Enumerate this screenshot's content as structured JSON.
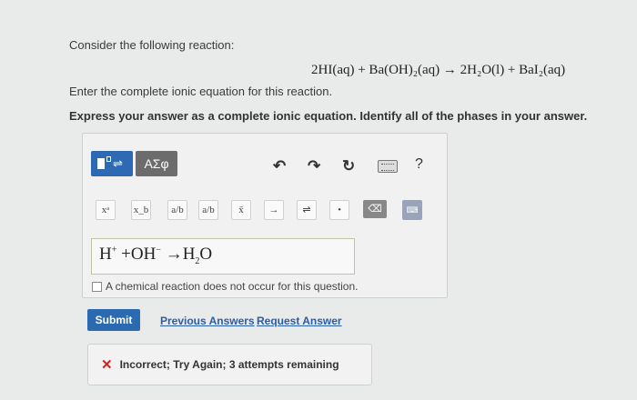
{
  "question": {
    "prompt": "Consider the following reaction:",
    "equation": "2HI(aq) + Ba(OH)₂(aq) → 2H₂O(l) + BaI₂(aq)",
    "instruction": "Enter the complete ionic equation for this reaction.",
    "express": "Express your answer as a complete ionic equation. Identify all of the phases in your answer."
  },
  "toolbar": {
    "greek_label": "ΑΣφ",
    "undo": "↶",
    "redo": "↷",
    "reset": "↻",
    "help": "?"
  },
  "keys": [
    "xᵃ",
    "x_b",
    "a/b",
    "a/b",
    "x̄",
    "→",
    "⇌",
    "•",
    "⌫",
    "⌨"
  ],
  "answer": {
    "h": "H",
    "h_sup": "+",
    "plus": "+",
    "oh": "OH",
    "oh_sup": "−",
    "arrow": "→",
    "h2o_h": "H",
    "h2o_sub": "2",
    "h2o_o": "O"
  },
  "no_reaction_label": "A chemical reaction does not occur for this question.",
  "actions": {
    "submit": "Submit",
    "previous": "Previous Answers",
    "request": "Request Answer"
  },
  "feedback": {
    "icon": "✕",
    "text": "Incorrect; Try Again; 3 attempts remaining"
  }
}
